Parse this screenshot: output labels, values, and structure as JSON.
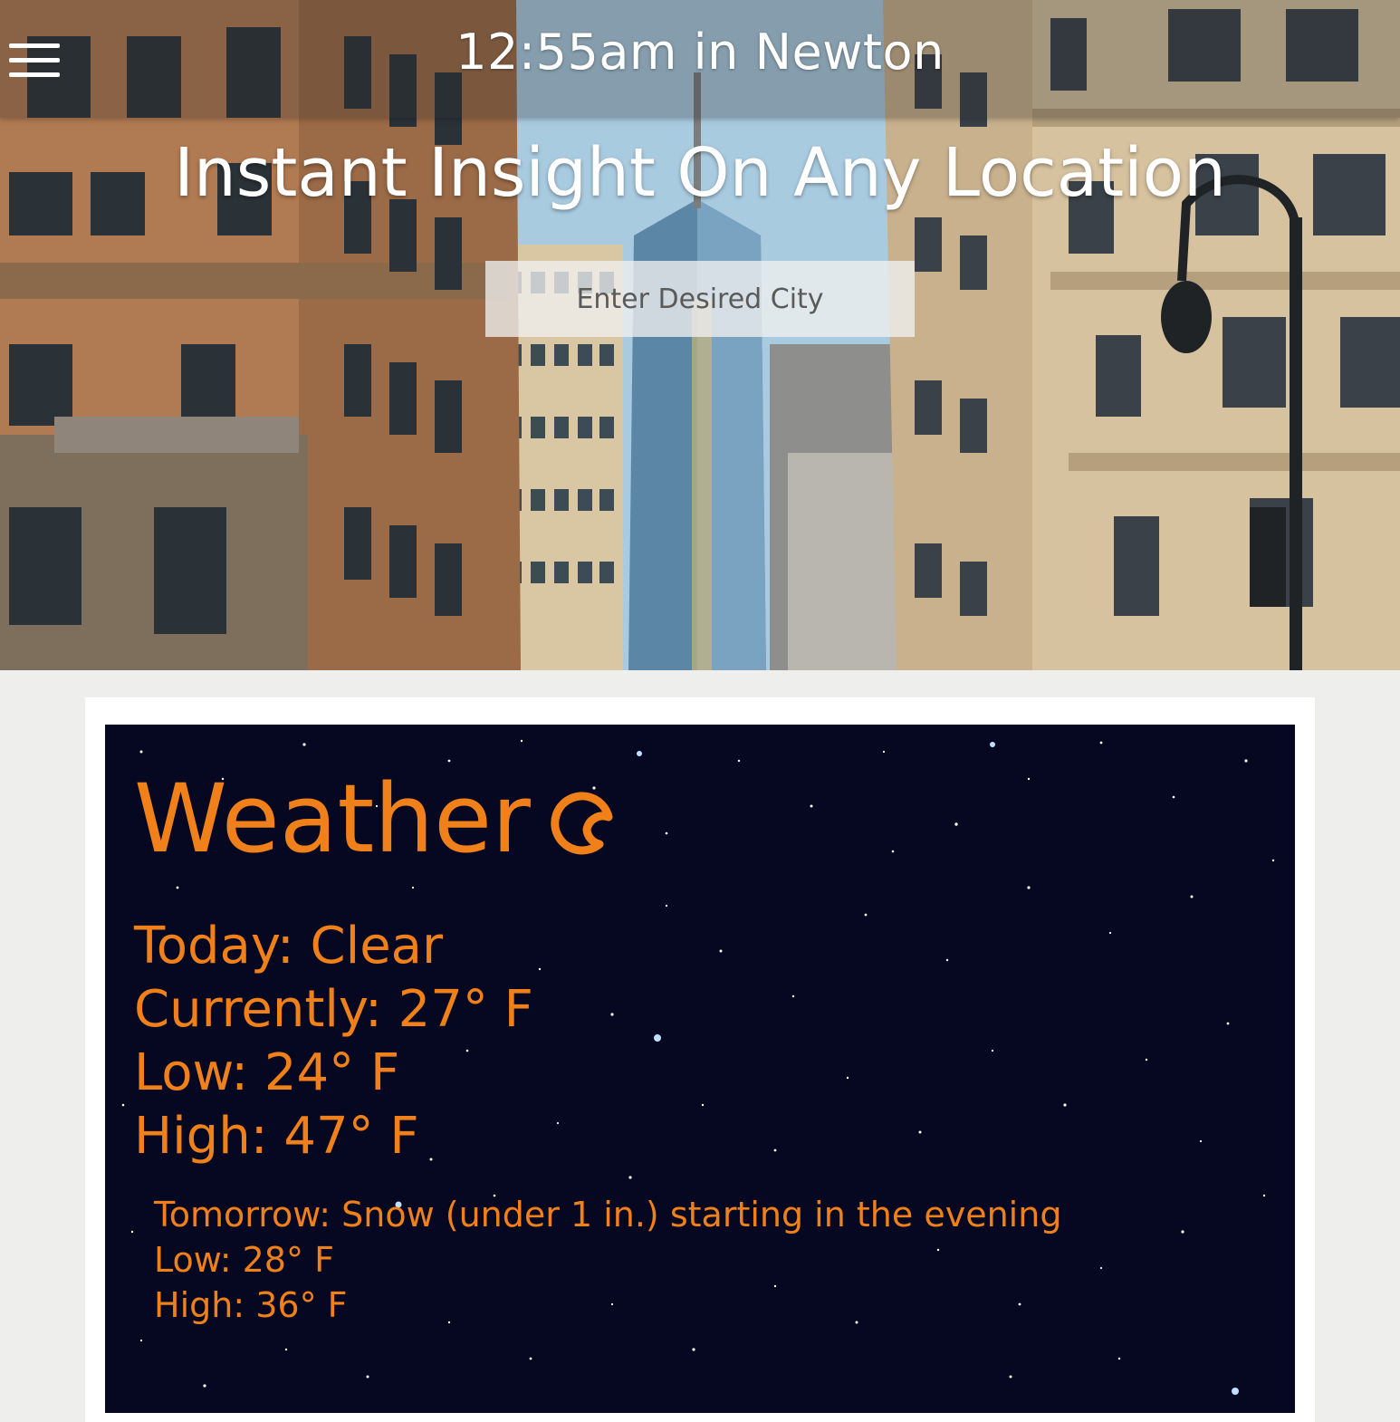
{
  "header": {
    "time_location": "12:55am in Newton",
    "tagline": "Instant Insight On Any Location"
  },
  "search": {
    "placeholder": "Enter Desired City",
    "value": ""
  },
  "weather": {
    "heading": "Weather",
    "icon": "clear-night-moon-icon",
    "today": {
      "summary": "Today: Clear",
      "current": "Currently: 27° F",
      "low": "Low: 24° F",
      "high": "High: 47° F"
    },
    "tomorrow": {
      "summary": "Tomorrow: Snow (under 1 in.) starting in the evening",
      "low": "Low: 28° F",
      "high": "High: 36° F"
    }
  },
  "colors": {
    "accent": "#f08019",
    "night_sky": "#060822",
    "page_background": "#eeefed"
  }
}
